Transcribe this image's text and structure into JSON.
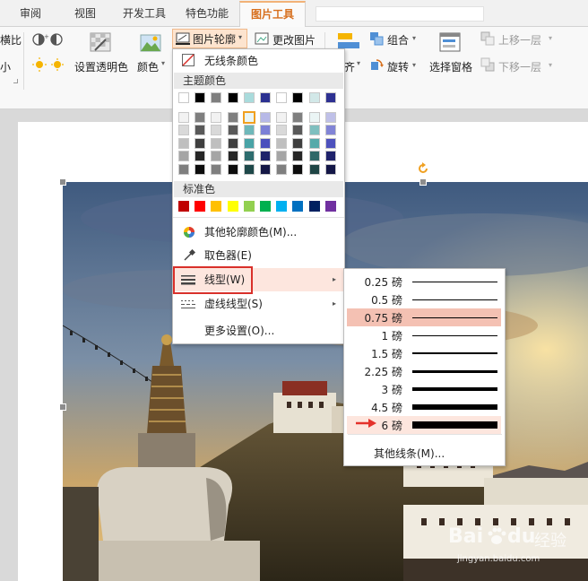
{
  "tabs": [
    "审阅",
    "视图",
    "开发工具",
    "特色功能",
    "图片工具"
  ],
  "ribbon": {
    "left_cut_top": "横比",
    "left_cut_bottom": "小",
    "set_transparent": "设置透明色",
    "color": "颜色",
    "picture_outline": "图片轮廓",
    "change_picture": "更改图片",
    "group": "组合",
    "rotate": "旋转",
    "align_cut": "齐",
    "selection_pane": "选择窗格",
    "bring_forward": "上移一层",
    "send_backward": "下移一层"
  },
  "menu": {
    "no_line_color": "无线条颜色",
    "theme_colors_header": "主题颜色",
    "standard_colors_header": "标准色",
    "more_outline_colors": "其他轮廓颜色(M)...",
    "eyedropper": "取色器(E)",
    "line_style": "线型(W)",
    "dash_style": "虚线线型(S)",
    "more_settings": "更多设置(O)..."
  },
  "theme_colors": {
    "top_row": [
      "#ffffff",
      "#000000",
      "#7f7f7f",
      "#000000",
      "#a9dbdc",
      "#2b3191",
      "#ffffff",
      "#000000",
      "#d2e8e8",
      "#2e3192"
    ],
    "rows": [
      [
        "#f2f2f2",
        "#7f7f7f",
        "#f2f2f2",
        "#7f7f7f",
        "#e9f5f6",
        "#b7b9e7",
        "#f2f2f2",
        "#7f7f7f",
        "#ebf5f5",
        "#bfc0e8"
      ],
      [
        "#d9d9d9",
        "#595959",
        "#d9d9d9",
        "#595959",
        "#6fb8ba",
        "#7c80d6",
        "#d9d9d9",
        "#595959",
        "#7fbfbf",
        "#8184d6"
      ],
      [
        "#bfbfbf",
        "#3f3f3f",
        "#bfbfbf",
        "#3f3f3f",
        "#49a3a6",
        "#4a4fbd",
        "#bfbfbf",
        "#3f3f3f",
        "#56aaaa",
        "#4d51bd"
      ],
      [
        "#a5a5a5",
        "#262626",
        "#a5a5a5",
        "#262626",
        "#2d6c6e",
        "#1f236a",
        "#a5a5a5",
        "#262626",
        "#2f6868",
        "#1f226b"
      ],
      [
        "#7f7f7f",
        "#0d0d0d",
        "#7f7f7f",
        "#0d0d0d",
        "#1e4849",
        "#151846",
        "#7f7f7f",
        "#0d0d0d",
        "#1f4545",
        "#141747"
      ]
    ]
  },
  "standard_colors": [
    "#c00000",
    "#ff0000",
    "#ffc000",
    "#ffff00",
    "#92d050",
    "#00b050",
    "#00b0f0",
    "#0070c0",
    "#002060",
    "#7030a0"
  ],
  "line_widths": [
    {
      "label": "0.25 磅",
      "pt": 0.25
    },
    {
      "label": "0.5 磅",
      "pt": 0.5
    },
    {
      "label": "0.75 磅",
      "pt": 0.75
    },
    {
      "label": "1 磅",
      "pt": 1
    },
    {
      "label": "1.5 磅",
      "pt": 1.5
    },
    {
      "label": "2.25 磅",
      "pt": 2.25
    },
    {
      "label": "3 磅",
      "pt": 3
    },
    {
      "label": "4.5 磅",
      "pt": 4.5
    },
    {
      "label": "6 磅",
      "pt": 6
    }
  ],
  "selected_line_width": "0.75 磅",
  "pointed_line_width": "6 磅",
  "more_lines": "其他线条(M)...",
  "watermark": {
    "brand_a": "Bai",
    "brand_b": "du",
    "brand_suffix": "经验",
    "url": "jingyan.baidu.com"
  },
  "colors": {
    "accent_orange": "#d76f1d",
    "highlight_red_box": "#d9302a",
    "selected_row": "#f4c1b3",
    "pointed_row": "#fde6de",
    "hover_row": "#fbe1d6"
  }
}
